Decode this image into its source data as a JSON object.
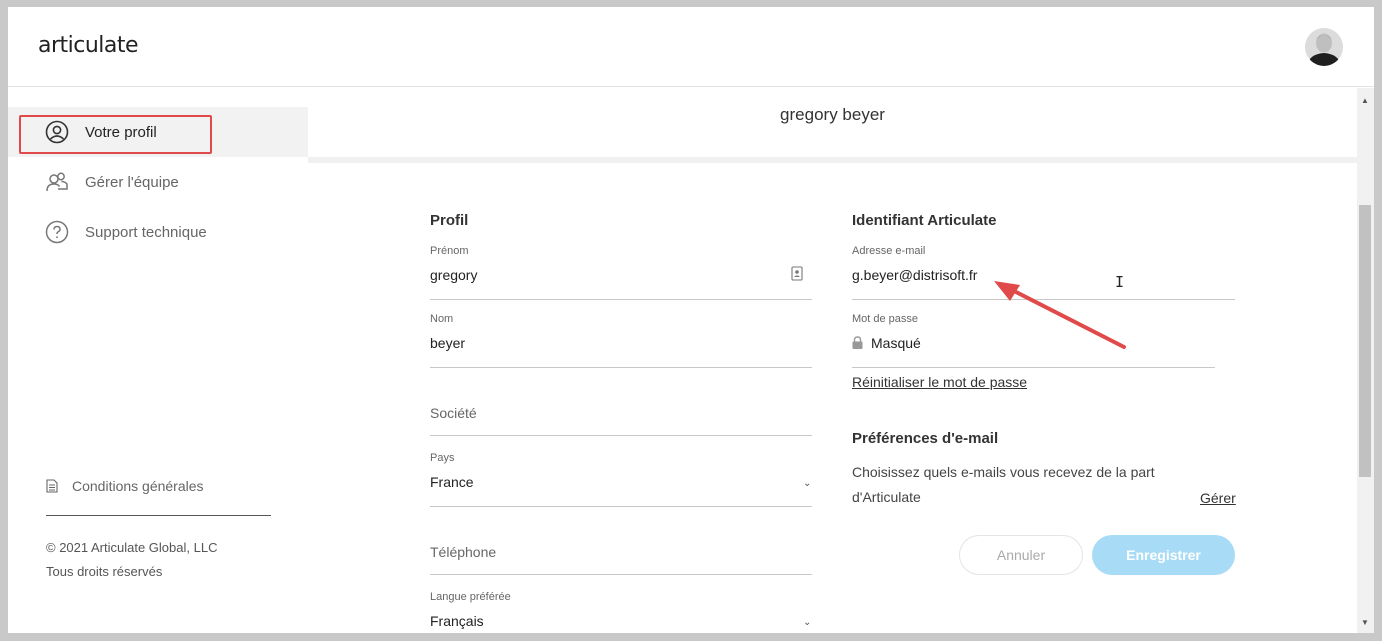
{
  "header": {
    "logo_text": "articulate"
  },
  "sidebar": {
    "items": [
      {
        "label": "Votre profil",
        "icon": "user-circle-icon"
      },
      {
        "label": "Gérer l'équipe",
        "icon": "team-icon"
      },
      {
        "label": "Support technique",
        "icon": "question-icon"
      }
    ],
    "terms_label": "Conditions générales",
    "copyright": "© 2021 Articulate Global, LLC",
    "rights": "Tous droits réservés"
  },
  "main": {
    "username": "gregory beyer",
    "profile": {
      "title": "Profil",
      "first_name_label": "Prénom",
      "first_name_value": "gregory",
      "last_name_label": "Nom",
      "last_name_value": "beyer",
      "company_placeholder": "Société",
      "country_label": "Pays",
      "country_value": "France",
      "phone_placeholder": "Téléphone",
      "language_label": "Langue préférée",
      "language_value": "Français"
    },
    "account": {
      "title": "Identifiant Articulate",
      "email_label": "Adresse e-mail",
      "email_value": "g.beyer@distrisoft.fr",
      "password_label": "Mot de passe",
      "password_value": "Masqué",
      "reset_link": "Réinitialiser le mot de passe"
    },
    "email_prefs": {
      "title": "Préférences d'e-mail",
      "description": "Choisissez quels e-mails vous recevez de la part d'Articulate",
      "manage_link": "Gérer"
    },
    "actions": {
      "cancel_label": "Annuler",
      "save_label": "Enregistrer"
    }
  },
  "colors": {
    "annotation_red": "#e04a4a",
    "save_button": "#a8dcf6",
    "active_nav_bg": "#f2f2f2"
  }
}
